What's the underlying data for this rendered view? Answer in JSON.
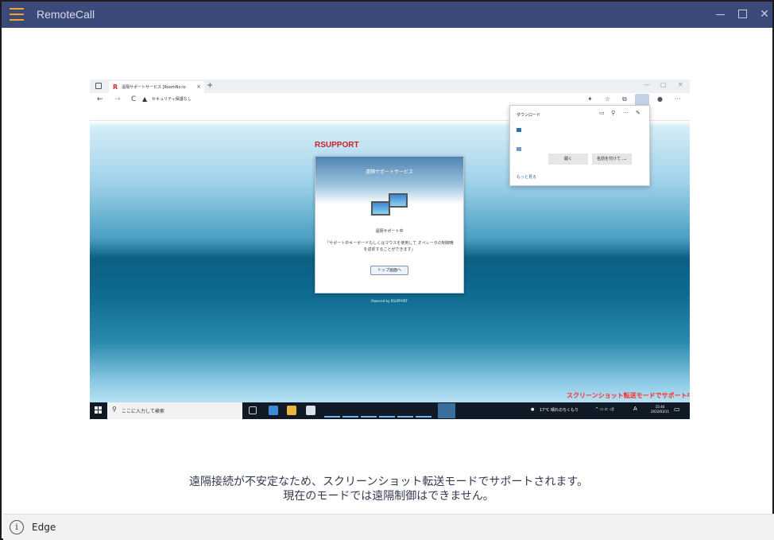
{
  "window": {
    "title": "RemoteCall",
    "minimize_glyph": "—",
    "maximize_glyph": "☐",
    "close_glyph": "✕"
  },
  "remote": {
    "browser": {
      "tab_logo": "R",
      "tab_title": "遠隔サポートサービス [RoomNo:lo",
      "tab_close": "×",
      "new_tab": "+",
      "url_warning": "セキュリティ保護なし",
      "back": "←",
      "forward": "→",
      "reload": "C",
      "menu": "···"
    },
    "page": {
      "logo": "RSUPPORT",
      "panel_title": "遠隔サポートサービス",
      "status": "遠隔サポート中",
      "message": "「サポート中キーボードもしくはマウスを使用して オペレータの制御権を返却することができます」",
      "top_button": "トップ画面へ",
      "powered_by": "Powered by RSUPPORT"
    },
    "download_popup": {
      "title": "ダウンロード",
      "open_button": "開く",
      "save_as_button": "名前を付けて...",
      "more_link": "もっと見る"
    },
    "overlay_text": "スクリーンショット転送モードでサポート中",
    "taskbar": {
      "search_placeholder": "ここに入力して検索",
      "weather": "17°C 晴れのちくもり",
      "ime": "A",
      "time": "15:44",
      "date": "2022/03/11"
    }
  },
  "notice": {
    "line1": "遠隔接続が不安定なため、スクリーンショット転送モードでサポートされます。",
    "line2": "現在のモードでは遠隔制御はできません。"
  },
  "status_bar": {
    "info_glyph": "i",
    "browser_label": "Edge"
  },
  "colors": {
    "titlebar": "#3b4a78",
    "accent": "#f3a22c",
    "overlay_red": "#ff2a2a"
  }
}
